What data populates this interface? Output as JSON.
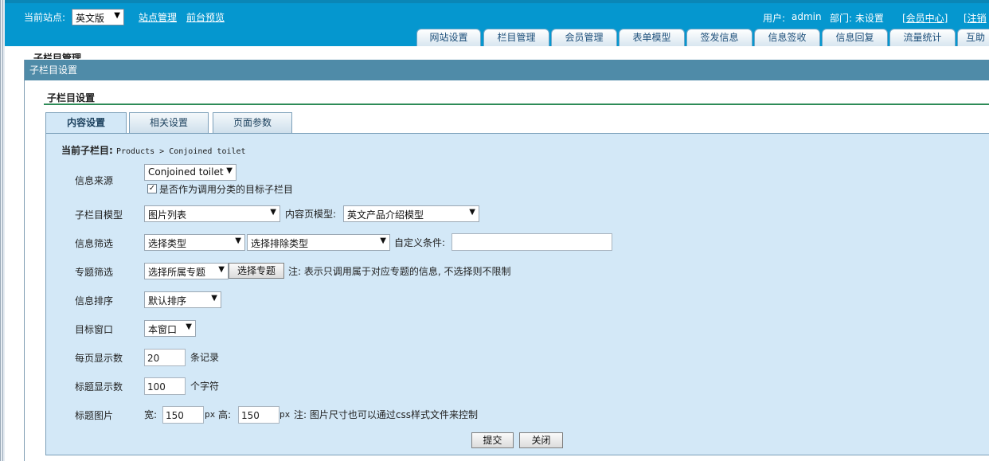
{
  "header": {
    "current_site_label": "当前站点:",
    "current_site_value": "英文版",
    "links": [
      "站点管理",
      "前台预览"
    ],
    "user_label": "用户:",
    "user_value": "admin",
    "dept_label": "部门: 未设置",
    "member_center": "[会员中心]",
    "logout": "[注销",
    "tabs": [
      "网站设置",
      "栏目管理",
      "会员管理",
      "表单模型",
      "签发信息",
      "信息签收",
      "信息回复",
      "流量统计",
      "互助"
    ]
  },
  "background_title": "子栏目管理",
  "dialog": {
    "title": "子栏目设置",
    "section_title": "子栏目设置",
    "tabs": [
      "内容设置",
      "相关设置",
      "页面参数"
    ],
    "current_label": "当前子栏目:",
    "current_path": "Products > Conjoined toilet",
    "fields": {
      "source_label": "信息来源",
      "source_value": "Conjoined toilet",
      "source_check": "是否作为调用分类的目标子栏目",
      "model_label": "子栏目模型",
      "model_value": "图片列表",
      "content_model_label": "内容页模型:",
      "content_model_value": "英文产品介绍模型",
      "filter_label": "信息筛选",
      "filter_type": "选择类型",
      "filter_exclude": "选择排除类型",
      "custom_cond_label": "自定义条件:",
      "custom_cond_value": "",
      "topic_label": "专题筛选",
      "topic_value": "选择所属专题",
      "topic_button": "选择专题",
      "topic_note": "注: 表示只调用属于对应专题的信息, 不选择则不限制",
      "sort_label": "信息排序",
      "sort_value": "默认排序",
      "window_label": "目标窗口",
      "window_value": "本窗口",
      "per_page_label": "每页显示数",
      "per_page_value": "20",
      "per_page_unit": "条记录",
      "title_len_label": "标题显示数",
      "title_len_value": "100",
      "title_len_unit": "个字符",
      "img_label": "标题图片",
      "img_w_label": "宽:",
      "img_w_value": "150",
      "img_px1": "px",
      "img_h_label": "高:",
      "img_h_value": "150",
      "img_px2": "px",
      "img_note": "注: 图片尺寸也可以通过css样式文件来控制"
    },
    "submit": "提交",
    "close": "关闭"
  }
}
